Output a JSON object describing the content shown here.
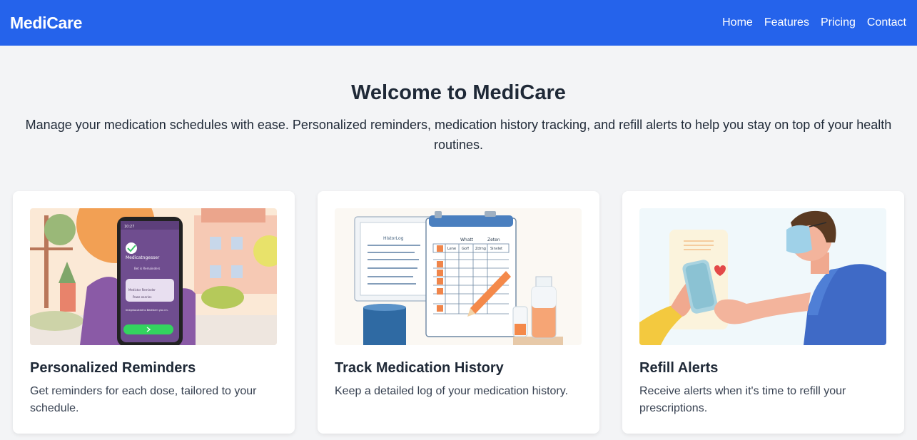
{
  "nav": {
    "brand": "MediCare",
    "links": [
      "Home",
      "Features",
      "Pricing",
      "Contact"
    ]
  },
  "hero": {
    "title": "Welcome to MediCare",
    "subtitle": "Manage your medication schedules with ease. Personalized reminders, medication history tracking, and refill alerts to help you stay on top of your health routines."
  },
  "cards": [
    {
      "title": "Personalized Reminders",
      "text": "Get reminders for each dose, tailored to your schedule.",
      "phone_heading": "Medicatngesser",
      "phone_line": "Bet is Remainders",
      "phone_box_title": "Medictor Reminder",
      "phone_box_line": "Powe eanries",
      "phone_footer": "Imegnlocated to Bestform you nn."
    },
    {
      "title": "Track Medication History",
      "text": "Keep a detailed log of your medication history.",
      "log_label": "HistorLog",
      "sheet_labels": [
        "Whatt",
        "Zeten"
      ],
      "sheet_columns": [
        "Lene",
        "Gof!",
        "Zdrng",
        "Sinvlet"
      ]
    },
    {
      "title": "Refill Alerts",
      "text": "Receive alerts when it's time to refill your prescriptions."
    }
  ],
  "colors": {
    "primary": "#2563eb",
    "background": "#f3f4f6",
    "card": "#ffffff"
  }
}
